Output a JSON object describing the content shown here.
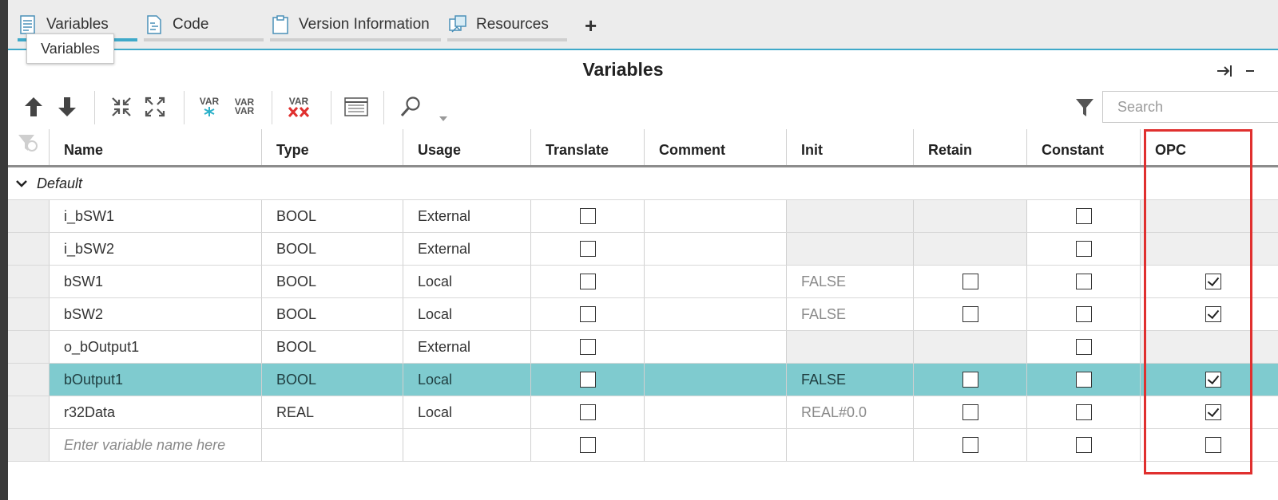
{
  "tabs": [
    {
      "label": "Variables",
      "icon": "variables-icon",
      "active": true
    },
    {
      "label": "Code",
      "icon": "code-icon",
      "active": false
    },
    {
      "label": "Version Information",
      "icon": "clipboard-icon",
      "active": false
    },
    {
      "label": "Resources",
      "icon": "resources-icon",
      "active": false
    }
  ],
  "add_tab_label": "+",
  "tooltip": "Variables",
  "panel": {
    "title": "Variables"
  },
  "toolbar": {
    "var_label": "VAR",
    "var_xx_label": "VAR",
    "search_placeholder": "Search"
  },
  "columns": [
    "Name",
    "Type",
    "Usage",
    "Translate",
    "Comment",
    "Init",
    "Retain",
    "Constant",
    "OPC"
  ],
  "group": {
    "label": "Default",
    "expanded": true
  },
  "rows": [
    {
      "name": "i_bSW1",
      "type": "BOOL",
      "usage": "External",
      "translate": false,
      "comment": "",
      "init": "",
      "retain": null,
      "constant": false,
      "opc": null,
      "selected": false
    },
    {
      "name": "i_bSW2",
      "type": "BOOL",
      "usage": "External",
      "translate": false,
      "comment": "",
      "init": "",
      "retain": null,
      "constant": false,
      "opc": null,
      "selected": false
    },
    {
      "name": "bSW1",
      "type": "BOOL",
      "usage": "Local",
      "translate": false,
      "comment": "",
      "init": "FALSE",
      "retain": false,
      "constant": false,
      "opc": true,
      "selected": false
    },
    {
      "name": "bSW2",
      "type": "BOOL",
      "usage": "Local",
      "translate": false,
      "comment": "",
      "init": "FALSE",
      "retain": false,
      "constant": false,
      "opc": true,
      "selected": false
    },
    {
      "name": "o_bOutput1",
      "type": "BOOL",
      "usage": "External",
      "translate": false,
      "comment": "",
      "init": "",
      "retain": null,
      "constant": false,
      "opc": null,
      "selected": false
    },
    {
      "name": "bOutput1",
      "type": "BOOL",
      "usage": "Local",
      "translate": false,
      "comment": "",
      "init": "FALSE",
      "retain": false,
      "constant": false,
      "opc": true,
      "selected": true
    },
    {
      "name": "r32Data",
      "type": "REAL",
      "usage": "Local",
      "translate": false,
      "comment": "",
      "init": "REAL#0.0",
      "retain": false,
      "constant": false,
      "opc": true,
      "selected": false
    }
  ],
  "new_row": {
    "placeholder": "Enter variable name here",
    "translate": false,
    "retain": false,
    "constant": false,
    "opc": false
  },
  "colors": {
    "accent": "#3fa9c9",
    "selected_row": "#7fcbcf",
    "highlight": "#e0302f"
  }
}
